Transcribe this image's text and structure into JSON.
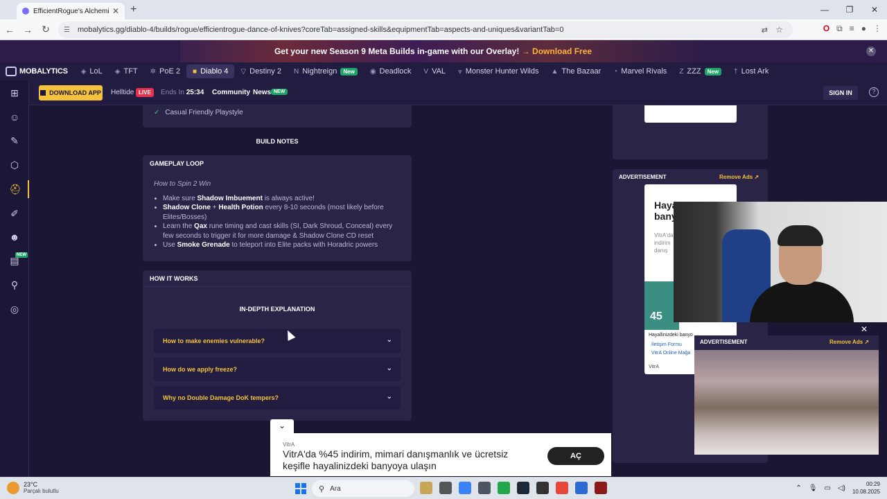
{
  "browser": {
    "tab_title": "EfficientRogue's Alchemist Dance",
    "url": "mobalytics.gg/diablo-4/builds/rogue/efficientrogue-dance-of-knives?coreTab=assigned-skills&equipmentTab=aspects-and-uniques&variantTab=0"
  },
  "promo": {
    "text": "Get your new Season 9 Meta Builds in-game with our Overlay!",
    "cta": "→ Download Free"
  },
  "gamenav": {
    "logo": "MOBALYTICS",
    "items": [
      {
        "label": "LoL",
        "icon": "lol-icon"
      },
      {
        "label": "TFT",
        "icon": "tft-icon"
      },
      {
        "label": "PoE 2",
        "icon": "poe2-icon"
      },
      {
        "label": "Diablo 4",
        "icon": "diablo4-icon"
      },
      {
        "label": "Destiny 2",
        "icon": "destiny2-icon"
      },
      {
        "label": "Nightreign",
        "icon": "nightreign-icon",
        "badge": "New"
      },
      {
        "label": "Deadlock",
        "icon": "deadlock-icon"
      },
      {
        "label": "VAL",
        "icon": "valorant-icon"
      },
      {
        "label": "Monster Hunter Wilds",
        "icon": "mhwilds-icon"
      },
      {
        "label": "The Bazaar",
        "icon": "bazaar-icon"
      },
      {
        "label": "Marvel Rivals",
        "icon": "marvel-rivals-icon"
      },
      {
        "label": "ZZZ",
        "icon": "zzz-icon",
        "badge": "New"
      },
      {
        "label": "Lost Ark",
        "icon": "lost-ark-icon"
      }
    ]
  },
  "subheader": {
    "download_label": "DOWNLOAD APP",
    "helltide": "Helltide",
    "live": "LIVE",
    "ends_label": "Ends In",
    "ends_time": "25:34",
    "community": "Community",
    "news": "News",
    "news_badge": "NEW",
    "signin": "SIGN IN"
  },
  "main": {
    "check_item": "Casual Friendly Playstyle",
    "build_notes_title": "BUILD NOTES",
    "gameplay_loop": {
      "title": "GAMEPLAY LOOP",
      "subtitle": "How to Spin 2 Win",
      "b1_pre": "Make sure ",
      "b1_bold": "Shadow Imbuement",
      "b1_post": " is always active!",
      "b2_bold1": "Shadow Clone",
      "b2_mid": " + ",
      "b2_bold2": "Health Potion",
      "b2_post": " every 8-10 seconds (most likely before Elites/Bosses)",
      "b3_pre": "Learn the ",
      "b3_bold": "Qax",
      "b3_post": " rune timing and cast skills (SI, Dark Shroud, Conceal) every few seconds to trigger it for more damage & Shadow Clone CD reset",
      "b4_pre": "Use ",
      "b4_bold": "Smoke Grenade",
      "b4_post": " to teleport into Elite packs with Horadric powers"
    },
    "how_it_works": {
      "title": "HOW IT WORKS",
      "subtitle": "IN-DEPTH EXPLANATION",
      "q1": "How to make enemies vulnerable?",
      "q2": "How do we apply freeze?",
      "q3": "Why no Double Damage DoK tempers?"
    }
  },
  "ads": {
    "advertisement": "ADVERTISEMENT",
    "remove_ads": "Remove Ads",
    "ad_head": "Hayal banyo",
    "ad_small1": "VitrA'da",
    "ad_small2": "indirim",
    "ad_small3": "danış",
    "ad_45": "45",
    "ad_caption": "Hayallinizdeki banyo",
    "ad_link1": "İletişim Formu",
    "ad_link2": "VitrA Online Mağa",
    "ad_brand": "VitrA",
    "bottom_brand": "VitrA",
    "bottom_text": "VitrA'da %45 indirim, mimari danışmanlık ve ücretsiz keşifle hayalinizdeki banyoya ulaşın",
    "bottom_cta": "AÇ"
  },
  "taskbar": {
    "temp": "23°C",
    "weather": "Parçalı bulutlu",
    "search": "Ara",
    "time": "00:29",
    "date": "10.08.2025"
  },
  "colors": {
    "accent": "#f4c23b",
    "bg": "#1a1633",
    "card": "#2a2447",
    "live": "#e5334f",
    "new_badge": "#1fa56a"
  }
}
